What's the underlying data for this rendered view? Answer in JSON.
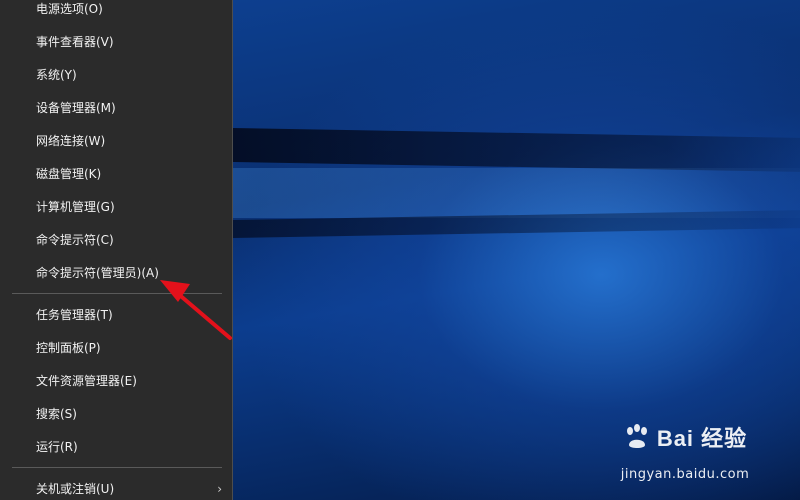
{
  "context_menu": {
    "items": [
      {
        "label": "电源选项(O)"
      },
      {
        "label": "事件查看器(V)"
      },
      {
        "label": "系统(Y)"
      },
      {
        "label": "设备管理器(M)"
      },
      {
        "label": "网络连接(W)"
      },
      {
        "label": "磁盘管理(K)"
      },
      {
        "label": "计算机管理(G)"
      },
      {
        "label": "命令提示符(C)"
      },
      {
        "label": "命令提示符(管理员)(A)"
      },
      {
        "label": "任务管理器(T)"
      },
      {
        "label": "控制面板(P)"
      },
      {
        "label": "文件资源管理器(E)"
      },
      {
        "label": "搜索(S)"
      },
      {
        "label": "运行(R)"
      },
      {
        "label": "关机或注销(U)"
      }
    ],
    "submenu_arrow": "›"
  },
  "watermark": {
    "brand": "Bai 经验",
    "url": "jingyan.baidu.com"
  },
  "colors": {
    "menu_background": "#2b2b2b",
    "menu_text": "#f2f2f2",
    "annotation_arrow": "#e3111b",
    "desktop_blue": "#0c3d8e"
  }
}
